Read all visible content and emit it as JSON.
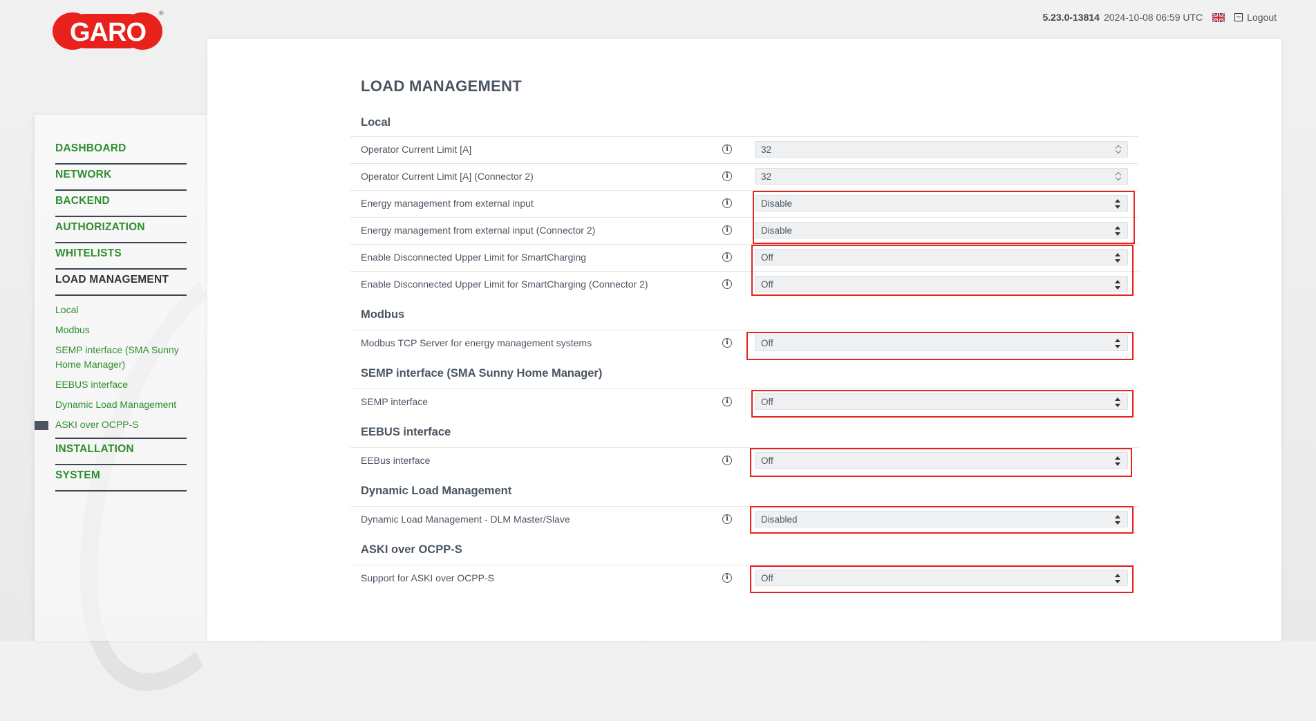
{
  "brand": {
    "logo_text": "GARO",
    "registered": "®"
  },
  "topbar": {
    "version": "5.23.0-13814",
    "datetime": "2024-10-08 06:59 UTC",
    "logout_label": "Logout"
  },
  "sidebar": {
    "top_items": [
      {
        "label": "DASHBOARD"
      },
      {
        "label": "NETWORK"
      },
      {
        "label": "BACKEND"
      },
      {
        "label": "AUTHORIZATION"
      },
      {
        "label": "WHITELISTS"
      },
      {
        "label": "LOAD MANAGEMENT"
      }
    ],
    "sub_items": [
      {
        "label": "Local"
      },
      {
        "label": "Modbus"
      },
      {
        "label": "SEMP interface (SMA Sunny Home Manager)"
      },
      {
        "label": "EEBUS interface"
      },
      {
        "label": "Dynamic Load Management"
      },
      {
        "label": "ASKI over OCPP-S"
      }
    ],
    "bottom_items": [
      {
        "label": "INSTALLATION"
      },
      {
        "label": "SYSTEM"
      }
    ]
  },
  "page": {
    "title": "LOAD MANAGEMENT"
  },
  "sections": {
    "local": {
      "title": "Local",
      "rows": [
        {
          "label": "Operator Current Limit [A]",
          "value": "32"
        },
        {
          "label": "Operator Current Limit [A] (Connector 2)",
          "value": "32"
        },
        {
          "label": "Energy management from external input",
          "value": "Disable"
        },
        {
          "label": "Energy management from external input (Connector 2)",
          "value": "Disable"
        },
        {
          "label": "Enable Disconnected Upper Limit for SmartCharging",
          "value": "Off"
        },
        {
          "label": "Enable Disconnected Upper Limit for SmartCharging (Connector 2)",
          "value": "Off"
        }
      ]
    },
    "modbus": {
      "title": "Modbus",
      "rows": [
        {
          "label": "Modbus TCP Server for energy management systems",
          "value": "Off"
        }
      ]
    },
    "semp": {
      "title": "SEMP interface (SMA Sunny Home Manager)",
      "rows": [
        {
          "label": "SEMP interface",
          "value": "Off"
        }
      ]
    },
    "eebus": {
      "title": "EEBUS interface",
      "rows": [
        {
          "label": "EEBus interface",
          "value": "Off"
        }
      ]
    },
    "dlm": {
      "title": "Dynamic Load Management",
      "rows": [
        {
          "label": "Dynamic Load Management - DLM Master/Slave",
          "value": "Disabled"
        }
      ]
    },
    "aski": {
      "title": "ASKI over OCPP-S",
      "rows": [
        {
          "label": "Support for ASKI over OCPP-S",
          "value": "Off"
        }
      ]
    }
  },
  "colors": {
    "brand_red": "#e8211c",
    "nav_green": "#2f8e2f",
    "text": "#4a5561",
    "highlight": "#e8211c"
  }
}
